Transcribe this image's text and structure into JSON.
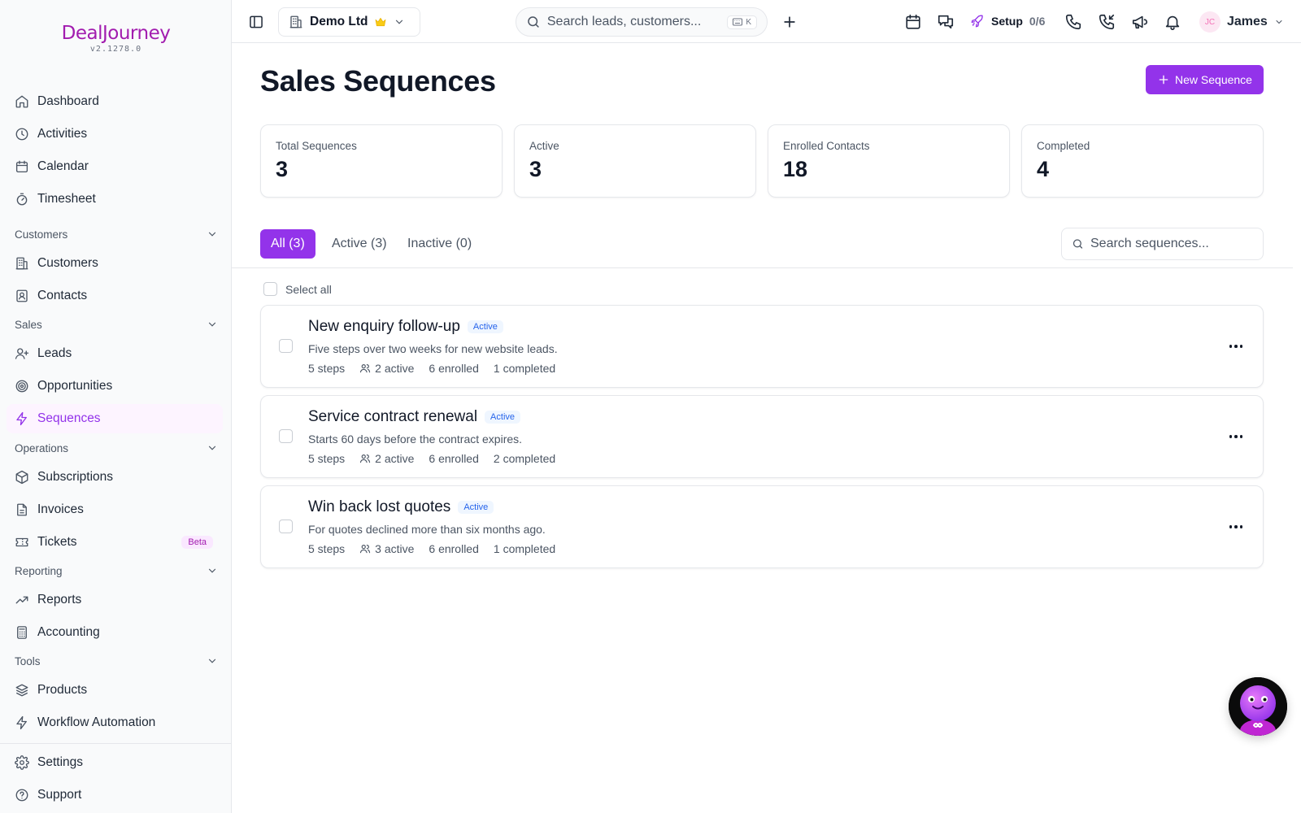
{
  "app": {
    "logo_text": "DealJourney",
    "version": "v2.1278.0"
  },
  "sidebar": {
    "top_items": [
      {
        "label": "Dashboard",
        "icon": "home-icon"
      },
      {
        "label": "Activities",
        "icon": "clock-icon"
      },
      {
        "label": "Calendar",
        "icon": "calendar-icon"
      },
      {
        "label": "Timesheet",
        "icon": "timer-icon"
      }
    ],
    "sections": [
      {
        "label": "Customers",
        "items": [
          {
            "label": "Customers",
            "icon": "building-icon"
          },
          {
            "label": "Contacts",
            "icon": "contact-icon"
          }
        ]
      },
      {
        "label": "Sales",
        "items": [
          {
            "label": "Leads",
            "icon": "user-plus-icon"
          },
          {
            "label": "Opportunities",
            "icon": "target-icon"
          },
          {
            "label": "Sequences",
            "icon": "lightning-icon",
            "active": true
          }
        ]
      },
      {
        "label": "Operations",
        "items": [
          {
            "label": "Subscriptions",
            "icon": "package-icon"
          },
          {
            "label": "Invoices",
            "icon": "file-icon"
          },
          {
            "label": "Tickets",
            "icon": "ticket-icon",
            "badge": "Beta"
          }
        ]
      },
      {
        "label": "Reporting",
        "items": [
          {
            "label": "Reports",
            "icon": "trending-icon"
          },
          {
            "label": "Accounting",
            "icon": "calculator-icon"
          }
        ]
      },
      {
        "label": "Tools",
        "items": [
          {
            "label": "Products",
            "icon": "layers-icon"
          },
          {
            "label": "Workflow Automation",
            "icon": "lightning-icon"
          }
        ]
      }
    ],
    "bottom_items": [
      {
        "label": "Settings",
        "icon": "gear-icon"
      },
      {
        "label": "Support",
        "icon": "help-icon"
      }
    ]
  },
  "topbar": {
    "company": "Demo Ltd",
    "search_placeholder": "Search leads, customers...",
    "search_shortcut": "K",
    "setup_label": "Setup",
    "setup_progress": "0/6",
    "user_initials": "JC",
    "user_name": "James"
  },
  "main": {
    "title": "Sales Sequences",
    "new_button": "New Sequence",
    "stats": [
      {
        "label": "Total Sequences",
        "value": "3"
      },
      {
        "label": "Active",
        "value": "3"
      },
      {
        "label": "Enrolled Contacts",
        "value": "18"
      },
      {
        "label": "Completed",
        "value": "4"
      }
    ],
    "tabs": [
      {
        "label": "All (3)",
        "active": true
      },
      {
        "label": "Active (3)"
      },
      {
        "label": "Inactive (0)"
      }
    ],
    "search_placeholder": "Search sequences...",
    "select_all": "Select all",
    "sequences": [
      {
        "title": "New enquiry follow-up",
        "status": "Active",
        "description": "Five steps over two weeks for new website leads.",
        "steps": "5 steps",
        "active": "2 active",
        "enrolled": "6 enrolled",
        "completed": "1 completed"
      },
      {
        "title": "Service contract renewal",
        "status": "Active",
        "description": "Starts 60 days before the contract expires.",
        "steps": "5 steps",
        "active": "2 active",
        "enrolled": "6 enrolled",
        "completed": "2 completed"
      },
      {
        "title": "Win back lost quotes",
        "status": "Active",
        "description": "For quotes declined more than six months ago.",
        "steps": "5 steps",
        "active": "3 active",
        "enrolled": "6 enrolled",
        "completed": "1 completed"
      }
    ]
  },
  "colors": {
    "accent": "#9333ea",
    "status_badge": "#2563eb"
  }
}
